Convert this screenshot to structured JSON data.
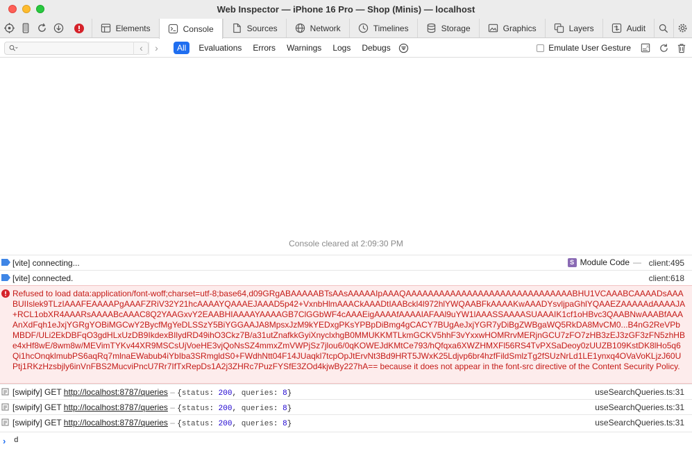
{
  "window": {
    "title": "Web Inspector — iPhone 16 Pro — Shop (Minis) — localhost"
  },
  "tabs": [
    {
      "label": "Elements",
      "icon": "elements-icon"
    },
    {
      "label": "Console",
      "icon": "console-icon",
      "active": true
    },
    {
      "label": "Sources",
      "icon": "sources-icon"
    },
    {
      "label": "Network",
      "icon": "network-icon"
    },
    {
      "label": "Timelines",
      "icon": "timelines-icon"
    },
    {
      "label": "Storage",
      "icon": "storage-icon"
    },
    {
      "label": "Graphics",
      "icon": "graphics-icon"
    },
    {
      "label": "Layers",
      "icon": "layers-icon"
    },
    {
      "label": "Audit",
      "icon": "audit-icon"
    }
  ],
  "filter": {
    "search_placeholder": "",
    "scopes": [
      "All",
      "Evaluations",
      "Errors",
      "Warnings",
      "Logs",
      "Debugs"
    ],
    "emulate_label": "Emulate User Gesture"
  },
  "console": {
    "cleared_text": "Console cleared at 2:09:30 PM",
    "messages": [
      {
        "text": "[vite] connecting...",
        "module_badge": "S",
        "module_label": "Module Code",
        "separator": "—",
        "location": "client:495"
      },
      {
        "text": "[vite] connected.",
        "location": "client:618"
      }
    ],
    "error": {
      "text": "Refused to load data:application/font-woff;charset=utf-8;base64,d09GRgABAAAAABTsAAsAAAAAIpAAAQAAAAAAAAAAAAAAAAAAAAAAAAAAAAAABHU1VCAAABCAAAADsAAABUIIslek9TLzIAAAFEAAAAPgAAAFZRiV32Y21hcAAAAYQAAAEJAAAD5p42+VxnbHlmAAACkAAADtIAABckl4l972hlYWQAABFkAAAAKwAAADYsvljpaGhlYQAAEZAAAAAdAAAAJA+RCL1obXR4AAARsAAAABcAAAC8Q2YAAGxvY2EAABHIAAAAYAAAAGB7ClGGbWF4cAAAEigAAAAfAAAAIAFAAl9uYW1lAAASSAAAASUAAAIK1cf1oHBvc3QAABNwAAABfAAAAnXdFqh1eJxjYGRgYOBiMGCwY2BycfMgYeDLSSzY5BiYGGAAJA8MpsxJzM9kYEDxgPKsYPBpDiBmg4gCACY7BUgAeJxjYGR7yDiBgZWBgaWQ5RkDA8MvCM0...B4nG2ReVPbMBDF/ULi2EkDBFqO3gdHLxUzDB9IkdexBIlydRD49ihO3Ckz7B/a31utZnafkkGyiXnyclxhgB0MMUKKMTLkmGCKV5hhF3vYxxwHOMRrvMERjnGCU7zFO7zHB3zEJ3zGF3zFN5zhHBe4xHf8wE/8wm8w/MEVimTYKv44XR9MSCsUjVoeHE3vjQoNsSZ4mmxZmVWPjSz7jlou6/0qKOWEJdKMtCe793/hQfqxa6XWZHMXFl56RS4TvPXSaDeoy0zUUZB109KstDK8lHo5q6Qi1hcOnqklmubPS6aqRq7mlnaEWabub4iYbIba3SRmgldS0+FWdhNtt04F14JUaqkl7tcpOpJtErvNt3Bd9HRT5JWxK25Ldjvp6br4hzfFildSmlzTg2fSUzNrLd1LE1ynxq4OVaVoKLjzJ60UPtj1RKzHzsbjly6inVnFBS2MucviPncU7Rr7IfTxRepDs1A2j3ZHRc7PuzFYSfE3ZOd4kjwBy227hA== because it does not appear in the font-src directive of the Content Security Policy."
    },
    "logs": [
      {
        "prefix": "[swipify] GET ",
        "url": "http://localhost:8787/queries",
        "dash": " – ",
        "open": "{",
        "status_key": "status",
        "status_val": "200",
        "comma": ", ",
        "queries_key": "queries",
        "queries_val": "8",
        "close": "}",
        "location": "useSearchQueries.ts:31"
      },
      {
        "prefix": "[swipify] GET ",
        "url": "http://localhost:8787/queries",
        "dash": " – ",
        "open": "{",
        "status_key": "status",
        "status_val": "200",
        "comma": ", ",
        "queries_key": "queries",
        "queries_val": "8",
        "close": "}",
        "location": "useSearchQueries.ts:31"
      },
      {
        "prefix": "[swipify] GET ",
        "url": "http://localhost:8787/queries",
        "dash": " – ",
        "open": "{",
        "status_key": "status",
        "status_val": "200",
        "comma": ", ",
        "queries_key": "queries",
        "queries_val": "8",
        "close": "}",
        "location": "useSearchQueries.ts:31"
      }
    ],
    "prompt_input": "d"
  },
  "colors": {
    "accent": "#1f6ef0",
    "error_text": "#c41a16",
    "error_bg": "#fdecec",
    "number": "#1c00cf"
  }
}
